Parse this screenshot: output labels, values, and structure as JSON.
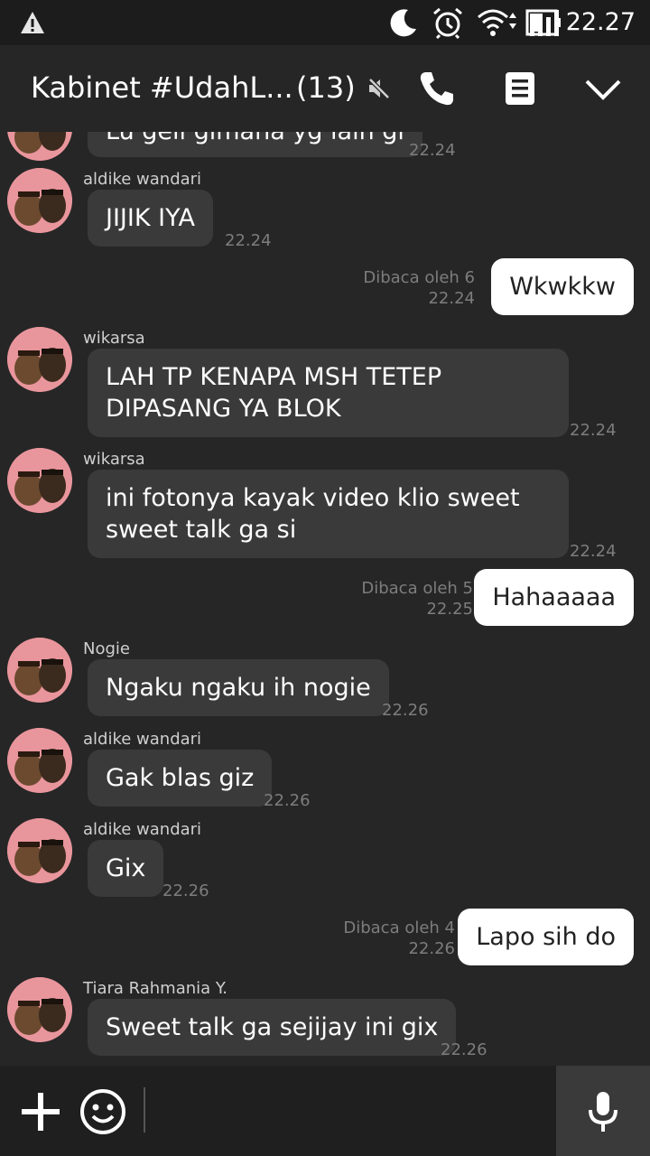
{
  "status_bar": {
    "time": "22.27",
    "icons": [
      "warning-icon",
      "moon-icon",
      "alarm-icon",
      "wifi-icon",
      "signal-icon",
      "battery-icon"
    ]
  },
  "header": {
    "title": "Kabinet #UdahL...",
    "member_count": "(13)",
    "icons": [
      "mute-icon",
      "phone-icon",
      "note-icon",
      "chevron-down-icon"
    ]
  },
  "messages": [
    {
      "direction": "in",
      "sender": "",
      "text": "Lu geli gimana yg lain gi",
      "time": "22.24"
    },
    {
      "direction": "in",
      "sender": "aldike wandari",
      "text": "JIJIK IYA",
      "time": "22.24"
    },
    {
      "direction": "out",
      "read": "Dibaca oleh 6",
      "text": "Wkwkkw",
      "time": "22.24"
    },
    {
      "direction": "in",
      "sender": "wikarsa",
      "text": "LAH TP KENAPA MSH TETEP\nDIPASANG YA BLOK",
      "time": "22.24"
    },
    {
      "direction": "in",
      "sender": "wikarsa",
      "text": "ini fotonya kayak video klio sweet\nsweet talk ga si",
      "time": "22.24"
    },
    {
      "direction": "out",
      "read": "Dibaca oleh 5",
      "text": "Hahaaaaa",
      "time": "22.25"
    },
    {
      "direction": "in",
      "sender": "Nogie",
      "text": "Ngaku ngaku ih nogie",
      "time": "22.26"
    },
    {
      "direction": "in",
      "sender": "aldike wandari",
      "text": "Gak blas giz",
      "time": "22.26"
    },
    {
      "direction": "in",
      "sender": "aldike wandari",
      "text": "Gix",
      "time": "22.26"
    },
    {
      "direction": "out",
      "read": "Dibaca oleh 4",
      "text": "Lapo sih do",
      "time": "22.26"
    },
    {
      "direction": "in",
      "sender": "Tiara Rahmania Y.",
      "text": "Sweet talk ga sejijay ini gix",
      "time": "22.26"
    }
  ],
  "input_bar": {
    "icons": [
      "plus-icon",
      "emoji-icon",
      "microphone-icon"
    ]
  }
}
